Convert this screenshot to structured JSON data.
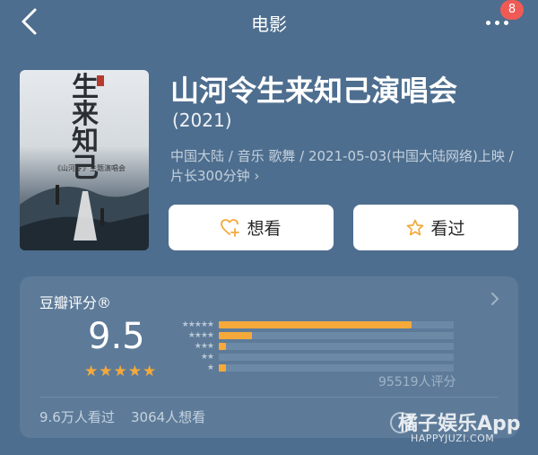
{
  "header": {
    "title": "电影",
    "badge": "8"
  },
  "movie": {
    "poster_title": "生来知己",
    "poster_subtitle": "《山河令》主题演唱会",
    "title": "山河令生来知己演唱会",
    "year": "(2021)",
    "info": "中国大陆 / 音乐 歌舞 / 2021-05-03(中国大陆网络)上映 / 片长300分钟 ›"
  },
  "actions": {
    "want_label": "想看",
    "seen_label": "看过"
  },
  "rating": {
    "title": "豆瓣评分®",
    "score": "9.5",
    "star_rating": 5,
    "count_label": "95519人评分",
    "distribution": [
      {
        "stars": "★★★★★",
        "fraction": 0.82
      },
      {
        "stars": "★★★★",
        "fraction": 0.14
      },
      {
        "stars": "★★★",
        "fraction": 0.03
      },
      {
        "stars": "★★",
        "fraction": 0.0
      },
      {
        "stars": "★",
        "fraction": 0.03
      }
    ],
    "seen_count": "9.6万人看过",
    "want_count": "3064人想看"
  },
  "watermark": {
    "brand": "橘子娱乐App",
    "url": "HAPPYJUZI.COM"
  },
  "colors": {
    "accent": "#f4a93a",
    "background": "#4e6e8f",
    "card": "#5d7b99",
    "badge": "#f05a55"
  },
  "icons": [
    "back-arrow-icon",
    "more-dots-icon",
    "heart-plus-icon",
    "star-outline-icon",
    "chevron-right-icon"
  ]
}
